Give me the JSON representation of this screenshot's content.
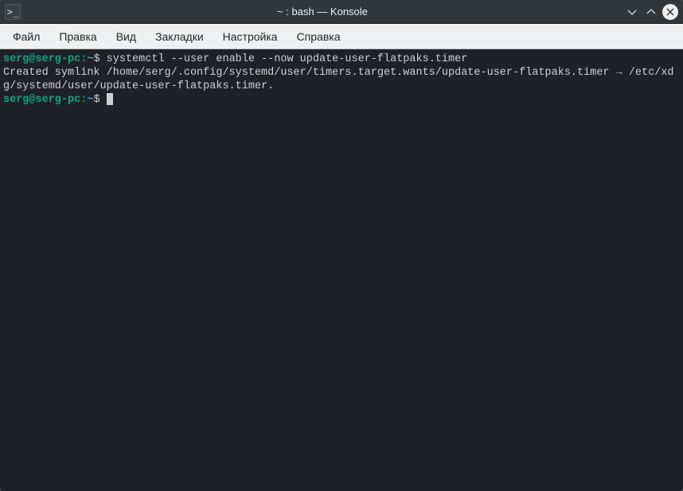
{
  "window": {
    "title": "~ : bash — Konsole",
    "app_icon_glyph": ">_"
  },
  "menubar": {
    "items": [
      "Файл",
      "Правка",
      "Вид",
      "Закладки",
      "Настройка",
      "Справка"
    ]
  },
  "terminal": {
    "lines": [
      {
        "type": "prompt",
        "user": "serg@serg-pc",
        "sep": ":",
        "path": "~",
        "dollar": "$",
        "command": "systemctl --user enable --now update-user-flatpaks.timer"
      },
      {
        "type": "output",
        "text": "Created symlink /home/serg/.config/systemd/user/timers.target.wants/update-user-flatpaks.timer → /etc/xdg/systemd/user/update-user-flatpaks.timer."
      },
      {
        "type": "prompt",
        "user": "serg@serg-pc",
        "sep": ":",
        "path": "~",
        "dollar": "$",
        "command": "",
        "cursor": true
      }
    ]
  }
}
